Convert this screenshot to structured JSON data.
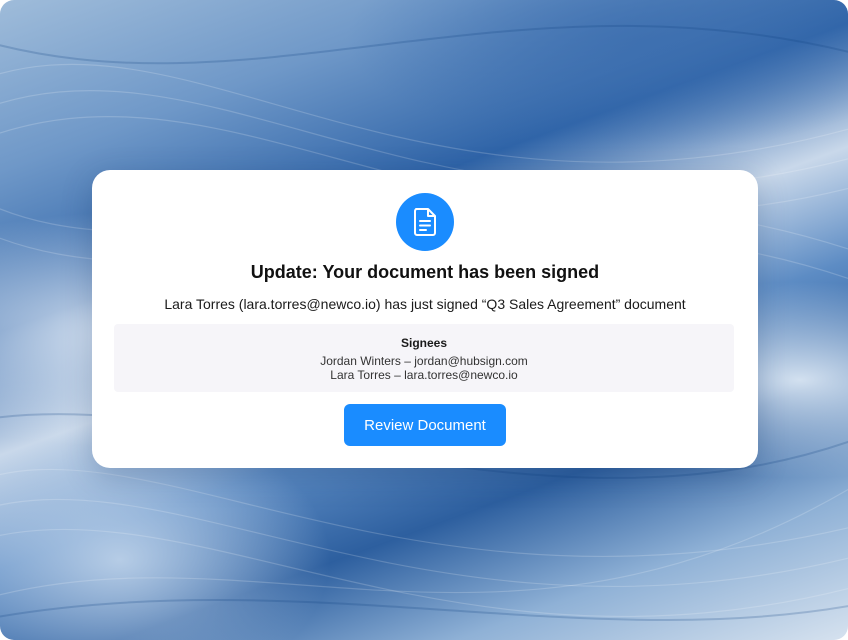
{
  "notification": {
    "icon": "document-icon",
    "accent_color": "#1a8cff",
    "title": "Update: Your document has been signed",
    "message": "Lara Torres (lara.torres@newco.io) has just signed “Q3 Sales Agreement” document",
    "signees": {
      "heading": "Signees",
      "items": [
        "Jordan Winters – jordan@hubsign.com",
        "Lara Torres – lara.torres@newco.io"
      ]
    },
    "review_button_label": "Review Document"
  }
}
